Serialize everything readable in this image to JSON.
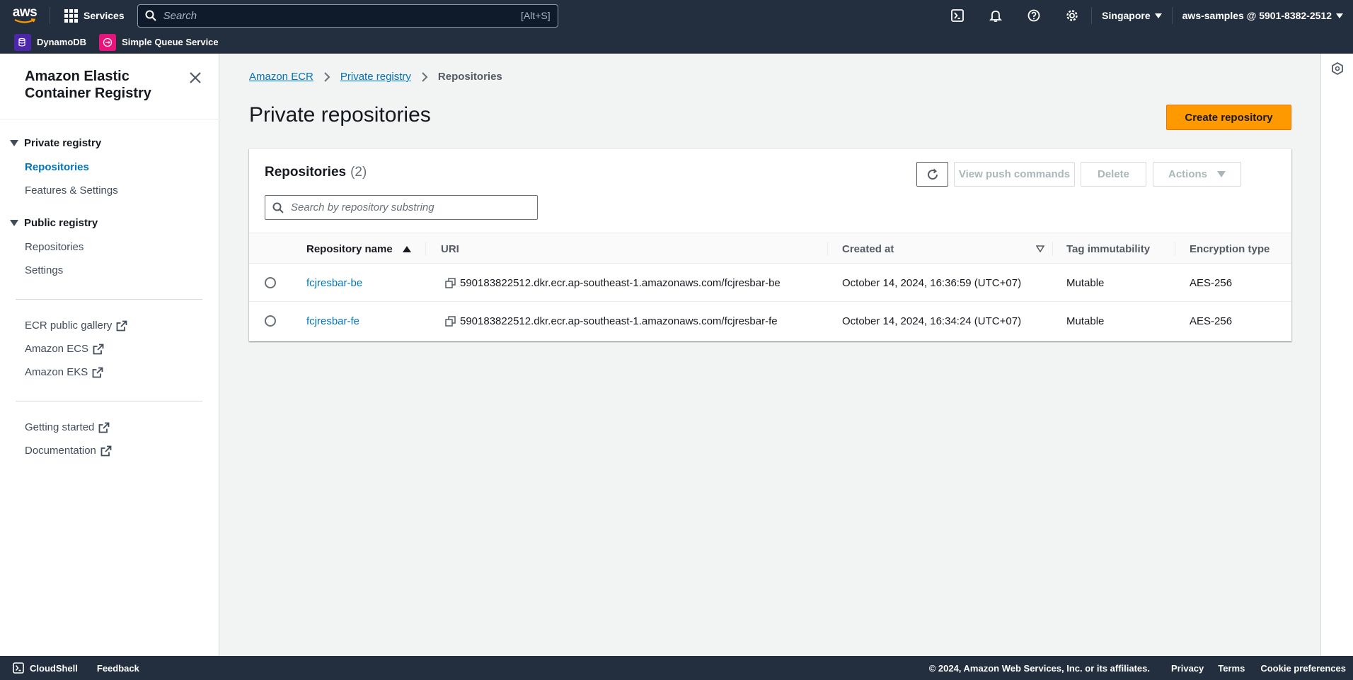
{
  "topnav": {
    "logo_text": "aws",
    "services_label": "Services",
    "search_placeholder": "Search",
    "search_shortcut": "[Alt+S]",
    "region": "Singapore",
    "account": "aws-samples @ 5901-8382-2512"
  },
  "favorites": [
    {
      "label": "DynamoDB",
      "color": "#4d27aa"
    },
    {
      "label": "Simple Queue Service",
      "color": "#e7157b"
    }
  ],
  "sidebar": {
    "title": "Amazon Elastic Container Registry",
    "private_section": "Private registry",
    "private_items": [
      "Repositories",
      "Features & Settings"
    ],
    "public_section": "Public registry",
    "public_items": [
      "Repositories",
      "Settings"
    ],
    "external_links": [
      "ECR public gallery",
      "Amazon ECS",
      "Amazon EKS"
    ],
    "help_links": [
      "Getting started",
      "Documentation"
    ]
  },
  "breadcrumb": [
    "Amazon ECR",
    "Private registry",
    "Repositories"
  ],
  "page_title": "Private repositories",
  "create_button": "Create repository",
  "panel": {
    "title": "Repositories",
    "count": "(2)",
    "view_push_label": "View push commands",
    "delete_label": "Delete",
    "actions_label": "Actions",
    "filter_placeholder": "Search by repository substring",
    "columns": [
      "Repository name",
      "URI",
      "Created at",
      "Tag immutability",
      "Encryption type"
    ],
    "rows": [
      {
        "name": "fcjresbar-be",
        "uri": "590183822512.dkr.ecr.ap-southeast-1.amazonaws.com/fcjresbar-be",
        "created": "October 14, 2024, 16:36:59 (UTC+07)",
        "immutability": "Mutable",
        "encryption": "AES-256"
      },
      {
        "name": "fcjresbar-fe",
        "uri": "590183822512.dkr.ecr.ap-southeast-1.amazonaws.com/fcjresbar-fe",
        "created": "October 14, 2024, 16:34:24 (UTC+07)",
        "immutability": "Mutable",
        "encryption": "AES-256"
      }
    ]
  },
  "footer": {
    "cloudshell": "CloudShell",
    "feedback": "Feedback",
    "copyright": "© 2024, Amazon Web Services, Inc. or its affiliates.",
    "privacy": "Privacy",
    "terms": "Terms",
    "cookies": "Cookie preferences"
  },
  "colors": {
    "nav_bg": "#232f3e",
    "link": "#0073bb",
    "primary": "#ff9900"
  }
}
